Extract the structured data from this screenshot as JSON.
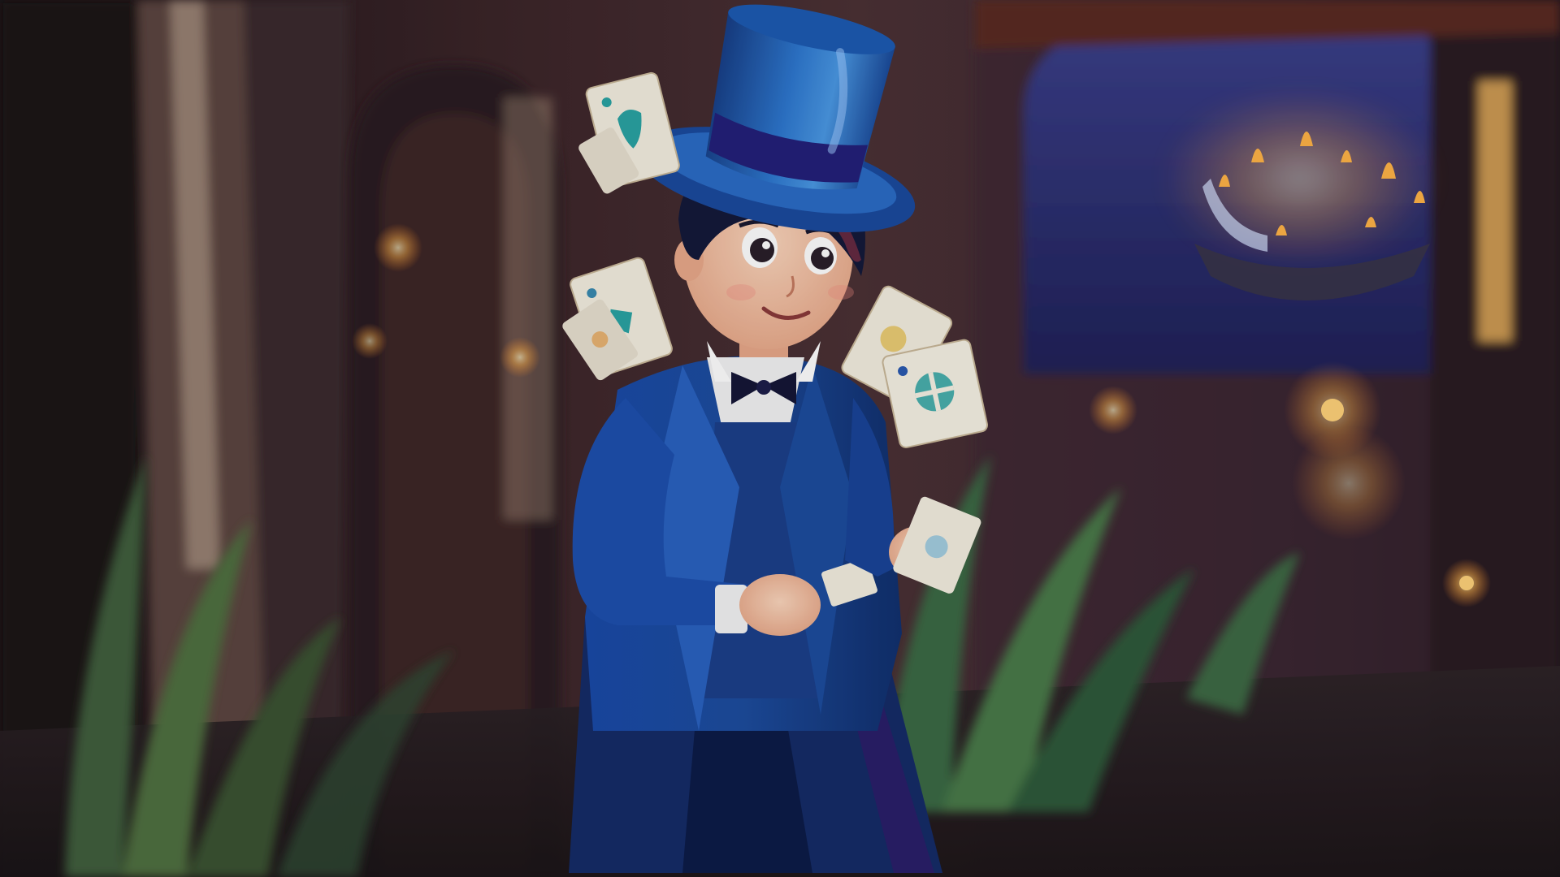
{
  "scene": {
    "subject": "magician-boy",
    "palette": {
      "background_dark": "#1c1320",
      "wall_warm": "#4a2f33",
      "wall_shadow": "#2a1b24",
      "arch_sky": "#2e3372",
      "curtain_light": "#c9b29a",
      "floor": "#2b2326",
      "hat_blue": "#1f5fb0",
      "hat_highlight": "#5aa0e6",
      "hat_band": "#23207a",
      "coat_blue": "#1c4aa0",
      "coat_shadow": "#102a66",
      "coat_lining": "#2a1f6a",
      "hair": "#141a3a",
      "skin": "#f3c3a4",
      "shirt": "#f2f2f4",
      "bowtie": "#151637",
      "plant_green": "#3f6b45",
      "flame": "#ffb347",
      "card_face": "#f4eee0",
      "card_symbol": "#2aa3a3"
    },
    "icons": {
      "floating_cards": "playing-card-icon",
      "lamps": "glowing-lamp-icon",
      "chandelier": "chandelier-icon",
      "plants": "plant-icon"
    }
  }
}
